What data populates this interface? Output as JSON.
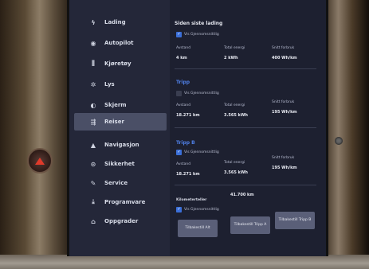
{
  "sidebar": {
    "items": [
      {
        "label": "Lading",
        "icon": "lightning-icon",
        "active": false
      },
      {
        "label": "Autopilot",
        "icon": "steering-wheel-icon",
        "active": false
      },
      {
        "label": "Kjøretøy",
        "icon": "vehicle-icon",
        "active": false
      },
      {
        "label": "Lys",
        "icon": "light-icon",
        "active": false
      },
      {
        "label": "Skjerm",
        "icon": "display-icon",
        "active": false
      },
      {
        "label": "Reiser",
        "icon": "trips-icon",
        "active": true
      },
      {
        "label": "Navigasjon",
        "icon": "navigation-icon",
        "active": false
      },
      {
        "label": "Sikkerhet",
        "icon": "shield-icon",
        "active": false
      },
      {
        "label": "Service",
        "icon": "wrench-icon",
        "active": false
      },
      {
        "label": "Programvare",
        "icon": "download-icon",
        "active": false
      },
      {
        "label": "Oppgrader",
        "icon": "lock-icon",
        "active": false
      }
    ]
  },
  "main": {
    "since_charge": {
      "title": "Siden siste lading",
      "checkbox_label": "Vis Gjennomsnittlig",
      "checked": true,
      "labels": [
        "Avstand",
        "Total energi",
        "Snitt forbruk"
      ],
      "values": [
        "4 km",
        "2 kWh",
        "400 Wh/km"
      ]
    },
    "trip_a": {
      "title": "Tripp",
      "checkbox_label": "Vis Gjennomsnittlig",
      "checked": false,
      "labels": [
        "Avstand",
        "Total energi",
        "Snitt forbruk"
      ],
      "values": [
        "18.271 km",
        "3.565 kWh",
        "195 Wh/km"
      ]
    },
    "trip_b": {
      "title": "Tripp B",
      "checkbox_label": "Vis Gjennomsnittlig",
      "checked": true,
      "labels": [
        "Avstand",
        "Total energi",
        "Snitt forbruk"
      ],
      "values": [
        "18.271 km",
        "3.565 kWh",
        "195 Wh/km"
      ]
    },
    "odometer": {
      "label": "Kilometerteller",
      "value": "41.700 km",
      "checkbox_label": "Vis Gjennomsnittlig",
      "checked": true
    },
    "buttons": [
      "Tilbakestill Alt",
      "Tilbakestill Tripp A",
      "Tilbakestill Tripp B"
    ]
  }
}
